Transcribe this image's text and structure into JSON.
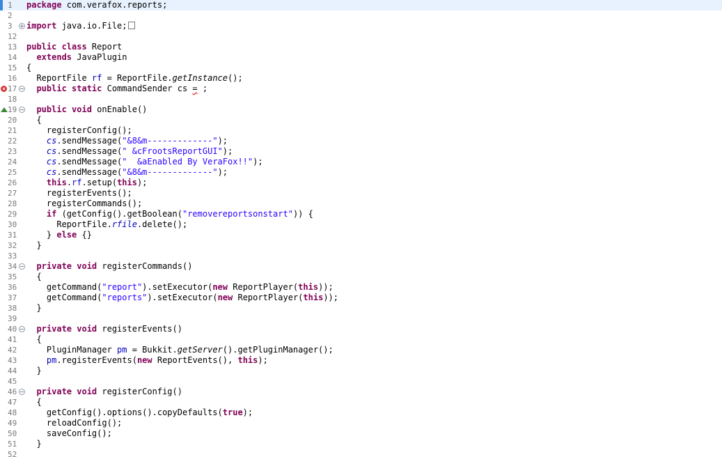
{
  "editor": {
    "lines": [
      {
        "n": "1",
        "current": true,
        "tokens": [
          {
            "t": "kw",
            "v": "package"
          },
          {
            "t": "p",
            "v": " com.verafox.reports;"
          }
        ]
      },
      {
        "n": "2",
        "tokens": []
      },
      {
        "n": "3",
        "fold": "plus",
        "tokens": [
          {
            "t": "kw",
            "v": "import"
          },
          {
            "t": "p",
            "v": " java.io.File;"
          },
          {
            "t": "foldbox",
            "v": ""
          }
        ]
      },
      {
        "n": "12",
        "tokens": []
      },
      {
        "n": "13",
        "tokens": [
          {
            "t": "kw",
            "v": "public class"
          },
          {
            "t": "p",
            "v": " Report"
          }
        ]
      },
      {
        "n": "14",
        "tokens": [
          {
            "t": "p",
            "v": "  "
          },
          {
            "t": "kw",
            "v": "extends"
          },
          {
            "t": "p",
            "v": " JavaPlugin"
          }
        ]
      },
      {
        "n": "15",
        "tokens": [
          {
            "t": "p",
            "v": "{"
          }
        ]
      },
      {
        "n": "16",
        "tokens": [
          {
            "t": "p",
            "v": "  ReportFile "
          },
          {
            "t": "field",
            "v": "rf"
          },
          {
            "t": "p",
            "v": " = ReportFile."
          },
          {
            "t": "italic",
            "v": "getInstance"
          },
          {
            "t": "p",
            "v": "();"
          }
        ]
      },
      {
        "n": "17",
        "marker": "error",
        "fold": "minus",
        "tokens": [
          {
            "t": "p",
            "v": "  "
          },
          {
            "t": "kw",
            "v": "public static"
          },
          {
            "t": "p",
            "v": " CommandSender cs "
          },
          {
            "t": "err",
            "v": "="
          },
          {
            "t": "p",
            "v": " ;"
          }
        ]
      },
      {
        "n": "18",
        "tokens": []
      },
      {
        "n": "19",
        "marker": "override",
        "fold": "minus",
        "tokens": [
          {
            "t": "p",
            "v": "  "
          },
          {
            "t": "kw",
            "v": "public void"
          },
          {
            "t": "p",
            "v": " onEnable()"
          }
        ]
      },
      {
        "n": "20",
        "tokens": [
          {
            "t": "p",
            "v": "  {"
          }
        ]
      },
      {
        "n": "21",
        "tokens": [
          {
            "t": "p",
            "v": "    registerConfig();"
          }
        ]
      },
      {
        "n": "22",
        "tokens": [
          {
            "t": "p",
            "v": "    "
          },
          {
            "t": "fielditalic",
            "v": "cs"
          },
          {
            "t": "p",
            "v": ".sendMessage("
          },
          {
            "t": "str",
            "v": "\"&8&m-------------\""
          },
          {
            "t": "p",
            "v": ");"
          }
        ]
      },
      {
        "n": "23",
        "tokens": [
          {
            "t": "p",
            "v": "    "
          },
          {
            "t": "fielditalic",
            "v": "cs"
          },
          {
            "t": "p",
            "v": ".sendMessage("
          },
          {
            "t": "str",
            "v": "\" &cFrootsReportGUI\""
          },
          {
            "t": "p",
            "v": ");"
          }
        ]
      },
      {
        "n": "24",
        "tokens": [
          {
            "t": "p",
            "v": "    "
          },
          {
            "t": "fielditalic",
            "v": "cs"
          },
          {
            "t": "p",
            "v": ".sendMessage("
          },
          {
            "t": "str",
            "v": "\"  &aEnabled By VeraFox!!\""
          },
          {
            "t": "p",
            "v": ");"
          }
        ]
      },
      {
        "n": "25",
        "tokens": [
          {
            "t": "p",
            "v": "    "
          },
          {
            "t": "fielditalic",
            "v": "cs"
          },
          {
            "t": "p",
            "v": ".sendMessage("
          },
          {
            "t": "str",
            "v": "\"&8&m-------------\""
          },
          {
            "t": "p",
            "v": ");"
          }
        ]
      },
      {
        "n": "26",
        "tokens": [
          {
            "t": "p",
            "v": "    "
          },
          {
            "t": "kw",
            "v": "this"
          },
          {
            "t": "p",
            "v": "."
          },
          {
            "t": "field",
            "v": "rf"
          },
          {
            "t": "p",
            "v": ".setup("
          },
          {
            "t": "kw",
            "v": "this"
          },
          {
            "t": "p",
            "v": ");"
          }
        ]
      },
      {
        "n": "27",
        "tokens": [
          {
            "t": "p",
            "v": "    registerEvents();"
          }
        ]
      },
      {
        "n": "28",
        "tokens": [
          {
            "t": "p",
            "v": "    registerCommands();"
          }
        ]
      },
      {
        "n": "29",
        "tokens": [
          {
            "t": "p",
            "v": "    "
          },
          {
            "t": "kw",
            "v": "if"
          },
          {
            "t": "p",
            "v": " (getConfig().getBoolean("
          },
          {
            "t": "str",
            "v": "\"removereportsonstart\""
          },
          {
            "t": "p",
            "v": ")) {"
          }
        ]
      },
      {
        "n": "30",
        "tokens": [
          {
            "t": "p",
            "v": "      ReportFile."
          },
          {
            "t": "fielditalic",
            "v": "rfile"
          },
          {
            "t": "p",
            "v": ".delete();"
          }
        ]
      },
      {
        "n": "31",
        "tokens": [
          {
            "t": "p",
            "v": "    } "
          },
          {
            "t": "kw",
            "v": "else"
          },
          {
            "t": "p",
            "v": " {}"
          }
        ]
      },
      {
        "n": "32",
        "tokens": [
          {
            "t": "p",
            "v": "  }"
          }
        ]
      },
      {
        "n": "33",
        "tokens": []
      },
      {
        "n": "34",
        "fold": "minus",
        "tokens": [
          {
            "t": "p",
            "v": "  "
          },
          {
            "t": "kw",
            "v": "private void"
          },
          {
            "t": "p",
            "v": " registerCommands()"
          }
        ]
      },
      {
        "n": "35",
        "tokens": [
          {
            "t": "p",
            "v": "  {"
          }
        ]
      },
      {
        "n": "36",
        "tokens": [
          {
            "t": "p",
            "v": "    getCommand("
          },
          {
            "t": "str",
            "v": "\"report\""
          },
          {
            "t": "p",
            "v": ").setExecutor("
          },
          {
            "t": "kw",
            "v": "new"
          },
          {
            "t": "p",
            "v": " ReportPlayer("
          },
          {
            "t": "kw",
            "v": "this"
          },
          {
            "t": "p",
            "v": "));"
          }
        ]
      },
      {
        "n": "37",
        "tokens": [
          {
            "t": "p",
            "v": "    getCommand("
          },
          {
            "t": "str",
            "v": "\"reports\""
          },
          {
            "t": "p",
            "v": ").setExecutor("
          },
          {
            "t": "kw",
            "v": "new"
          },
          {
            "t": "p",
            "v": " ReportPlayer("
          },
          {
            "t": "kw",
            "v": "this"
          },
          {
            "t": "p",
            "v": "));"
          }
        ]
      },
      {
        "n": "38",
        "tokens": [
          {
            "t": "p",
            "v": "  }"
          }
        ]
      },
      {
        "n": "39",
        "tokens": []
      },
      {
        "n": "40",
        "fold": "minus",
        "tokens": [
          {
            "t": "p",
            "v": "  "
          },
          {
            "t": "kw",
            "v": "private void"
          },
          {
            "t": "p",
            "v": " registerEvents()"
          }
        ]
      },
      {
        "n": "41",
        "tokens": [
          {
            "t": "p",
            "v": "  {"
          }
        ]
      },
      {
        "n": "42",
        "tokens": [
          {
            "t": "p",
            "v": "    PluginManager "
          },
          {
            "t": "field",
            "v": "pm"
          },
          {
            "t": "p",
            "v": " = Bukkit."
          },
          {
            "t": "italic",
            "v": "getServer"
          },
          {
            "t": "p",
            "v": "().getPluginManager();"
          }
        ]
      },
      {
        "n": "43",
        "tokens": [
          {
            "t": "p",
            "v": "    "
          },
          {
            "t": "field",
            "v": "pm"
          },
          {
            "t": "p",
            "v": ".registerEvents("
          },
          {
            "t": "kw",
            "v": "new"
          },
          {
            "t": "p",
            "v": " ReportEvents(), "
          },
          {
            "t": "kw",
            "v": "this"
          },
          {
            "t": "p",
            "v": ");"
          }
        ]
      },
      {
        "n": "44",
        "tokens": [
          {
            "t": "p",
            "v": "  }"
          }
        ]
      },
      {
        "n": "45",
        "tokens": []
      },
      {
        "n": "46",
        "fold": "minus",
        "tokens": [
          {
            "t": "p",
            "v": "  "
          },
          {
            "t": "kw",
            "v": "private void"
          },
          {
            "t": "p",
            "v": " registerConfig()"
          }
        ]
      },
      {
        "n": "47",
        "tokens": [
          {
            "t": "p",
            "v": "  {"
          }
        ]
      },
      {
        "n": "48",
        "tokens": [
          {
            "t": "p",
            "v": "    getConfig().options().copyDefaults("
          },
          {
            "t": "kw",
            "v": "true"
          },
          {
            "t": "p",
            "v": ");"
          }
        ]
      },
      {
        "n": "49",
        "tokens": [
          {
            "t": "p",
            "v": "    reloadConfig();"
          }
        ]
      },
      {
        "n": "50",
        "tokens": [
          {
            "t": "p",
            "v": "    saveConfig();"
          }
        ]
      },
      {
        "n": "51",
        "tokens": [
          {
            "t": "p",
            "v": "  }"
          }
        ]
      },
      {
        "n": "52",
        "tokens": []
      }
    ]
  }
}
